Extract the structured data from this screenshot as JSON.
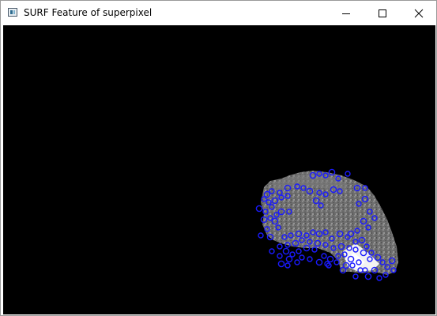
{
  "window": {
    "title": "SURF Feature of superpixel",
    "icon": "app-window-icon"
  },
  "controls": {
    "minimize_icon": "minimize-icon",
    "maximize_icon": "maximize-icon",
    "close_icon": "close-icon"
  },
  "canvas": {
    "background_color": "#000000",
    "keypoint_color": "#1a1aff",
    "superpixel_color": "#8a8a8a"
  }
}
